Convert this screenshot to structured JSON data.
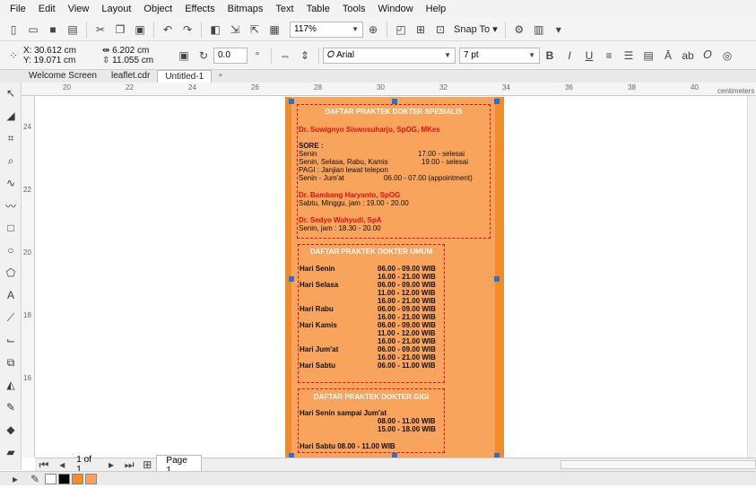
{
  "menu": [
    "File",
    "Edit",
    "View",
    "Layout",
    "Object",
    "Effects",
    "Bitmaps",
    "Text",
    "Table",
    "Tools",
    "Window",
    "Help"
  ],
  "toolbar": {
    "zoom": "117%",
    "snap_to": "Snap To"
  },
  "property_bar": {
    "x": "X: 30.612 cm",
    "y": "Y: 19.071 cm",
    "width": "6.202 cm",
    "height": "11.055 cm",
    "rotation": "0.0",
    "font": "Arial",
    "font_size": "7 pt"
  },
  "tabs": [
    "Welcome Screen",
    "leaflet.cdr",
    "Untitled-1"
  ],
  "ruler": {
    "marks": [
      "20",
      "22",
      "24",
      "26",
      "28",
      "30",
      "32",
      "34",
      "36",
      "38",
      "40"
    ],
    "unit": "centimeters",
    "vmarks": [
      "24",
      "22",
      "20",
      "18",
      "16"
    ]
  },
  "doc": {
    "spesialis": {
      "title": "DAFTAR PRAKTEK DOKTER SPESIALIS",
      "doctor1": "Dr. Suwignyo Siswosuharjo, SpOG, MKes",
      "sore": "SORE :",
      "l1a": "Senin",
      "l1b": "17.00 - selesai",
      "l2a": "Senin, Selasa, Rabu, Kamis",
      "l2b": "19.00 - selesai",
      "pagi": "PAGI : Janjian lewat telepon",
      "l3a": "Senin - Jum'at",
      "l3b": "06.00 - 07.00 (appointment)",
      "doctor2": "Dr. Bambang Haryanto, SpOG",
      "d2sched": "Sabtu, Minggu, jam : 19.00 - 20.00",
      "doctor3": "Dr. Sedyo Wahyudi, SpA",
      "d3sched": "Senin, jam : 18.30 - 20.00"
    },
    "umum": {
      "title": "DAFTAR PRAKTEK DOKTER UMUM",
      "rows": [
        [
          "Hari Senin",
          "06.00 - 09.00 WIB"
        ],
        [
          "",
          "16.00 - 21.00 WIB"
        ],
        [
          "Hari Selasa",
          "06.00 - 09.00 WIB"
        ],
        [
          "",
          "11.00 - 12.00 WIB"
        ],
        [
          "",
          "16.00 - 21.00 WIB"
        ],
        [
          "Hari Rabu",
          "06.00 - 09.00 WIB"
        ],
        [
          "",
          "16.00 - 21.00 WIB"
        ],
        [
          "Hari Kamis",
          "06.00 - 09.00 WIB"
        ],
        [
          "",
          "11.00 - 12.00 WIB"
        ],
        [
          "",
          "16.00 - 21.00 WIB"
        ],
        [
          "Hari Jum'at",
          "06.00 - 09.00 WIB"
        ],
        [
          "",
          "16.00 - 21.00 WIB"
        ],
        [
          "Hari Sabtu",
          "06.00 - 11.00 WIB"
        ]
      ]
    },
    "gigi": {
      "title": "DAFTAR PRAKTEK DOKTER GIGI",
      "l1": "Hari Senin sampai Jum'at",
      "l2": "08.00 - 11.00 WIB",
      "l3": "15.00 - 18.00 WIB",
      "l4": "Hari Sabtu 08.00 - 11.00 WIB"
    }
  },
  "pagenav": {
    "count": "1 of 1",
    "page": "Page 1"
  },
  "colors": {
    "page": "#f08c2c",
    "content": "#f9a45d",
    "accent": "#e01010"
  }
}
